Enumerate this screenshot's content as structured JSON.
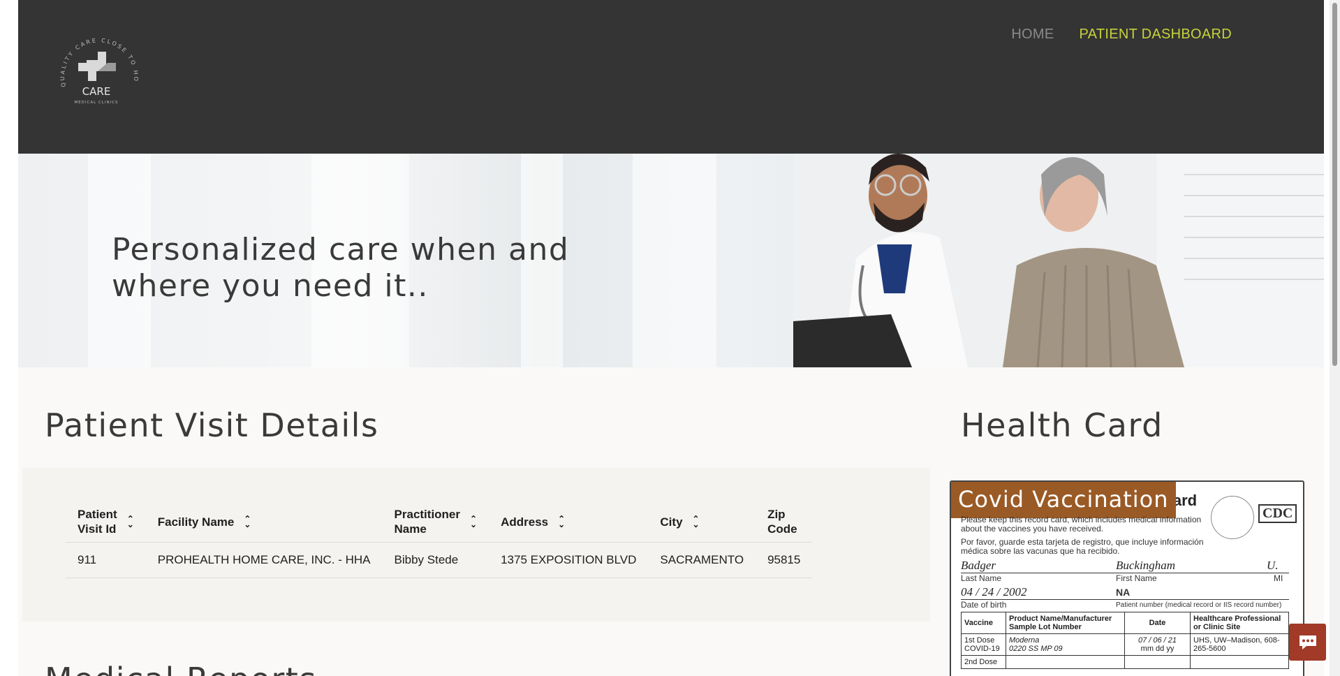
{
  "nav": {
    "home": "HOME",
    "patient_dashboard": "PATIENT DASHBOARD"
  },
  "logo": {
    "tagline": "QUALITY CARE CLOSE TO HOME",
    "name": "CARE",
    "sub": "MEDICAL CLINICS"
  },
  "hero": {
    "line1": "Personalized care when and",
    "line2": "where you need it.."
  },
  "sections": {
    "visit_title": "Patient Visit Details",
    "health_title": "Health Card",
    "reports_title": "Medical Reports"
  },
  "table": {
    "headers": [
      {
        "l1": "Patient",
        "l2": "Visit Id",
        "sortable": true
      },
      {
        "l1": "Facility Name",
        "l2": "",
        "sortable": true
      },
      {
        "l1": "Practitioner",
        "l2": "Name",
        "sortable": true
      },
      {
        "l1": "Address",
        "l2": "",
        "sortable": true
      },
      {
        "l1": "City",
        "l2": "",
        "sortable": true
      },
      {
        "l1": "Zip",
        "l2": "Code",
        "sortable": false
      }
    ],
    "rows": [
      {
        "visit_id": "911",
        "facility": "PROHEALTH HOME CARE, INC. - HHA",
        "practitioner": "Bibby Stede",
        "address": "1375 EXPOSITION BLVD",
        "city": "SACRAMENTO",
        "zip": "95815"
      }
    ]
  },
  "card": {
    "banner": "Covid Vaccination",
    "card_word": "Card",
    "cdc": "CDC",
    "note_en": "Please keep this record card, which includes medical information about the vaccines you have received.",
    "note_es": "Por favor, guarde esta tarjeta de registro, que incluye información médica sobre las vacunas que ha recibido.",
    "last_name": "Badger",
    "first_name": "Buckingham",
    "mi": "U.",
    "label_last": "Last Name",
    "label_first": "First Name",
    "label_mi": "MI",
    "dob": "04 / 24 / 2002",
    "label_dob": "Date of birth",
    "patient_number": "NA",
    "label_patient_number": "Patient number (medical record or IIS record number)",
    "col_vaccine": "Vaccine",
    "col_product": "Product Name/Manufacturer",
    "col_lot": "Sample Lot Number",
    "col_date": "Date",
    "col_site": "Healthcare Professional or Clinic Site",
    "dose1_label": "1st Dose COVID-19",
    "dose1_product": "Moderna",
    "dose1_lot": "0220 SS MP 09",
    "dose1_date": "07 / 06 / 21",
    "dose1_date_fmt": "mm dd yy",
    "dose1_site": "UHS, UW–Madison, 608-265-5600",
    "dose2_label": "2nd Dose"
  },
  "colors": {
    "header_bg": "#343434",
    "nav_active": "#c6d43a",
    "nav_inactive": "#8a8a8a",
    "banner": "#9a5a26",
    "chat": "#a13a27"
  }
}
